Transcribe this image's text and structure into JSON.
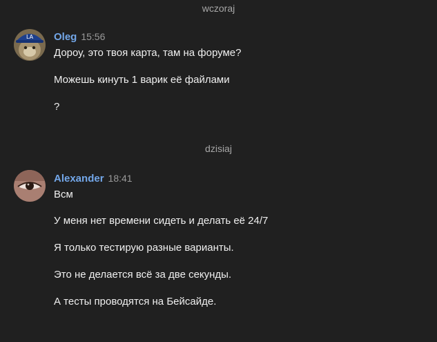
{
  "separators": {
    "yesterday": "wczoraj",
    "today": "dzisiaj"
  },
  "messages": [
    {
      "author": "Oleg",
      "time": "15:56",
      "avatar_icon": "oleg-avatar-cat-with-cap",
      "lines": [
        "Дороу, это твоя карта, там на форуме?",
        "Можешь кинуть 1 варик её файлами",
        "?"
      ]
    },
    {
      "author": "Alexander",
      "time": "18:41",
      "avatar_icon": "alexander-avatar-eye",
      "lines": [
        "Всм",
        "У меня нет времени сидеть и делать её 24/7",
        "Я только тестирую разные варианты.",
        "Это не делается всё за две секунды.",
        "А тесты проводятся на Бейсайде."
      ]
    }
  ],
  "colors": {
    "background": "#202020",
    "author": "#73a7e9",
    "timestamp": "#9a9a9a",
    "separator": "#a7a7a7",
    "text": "#f0f0f0"
  }
}
